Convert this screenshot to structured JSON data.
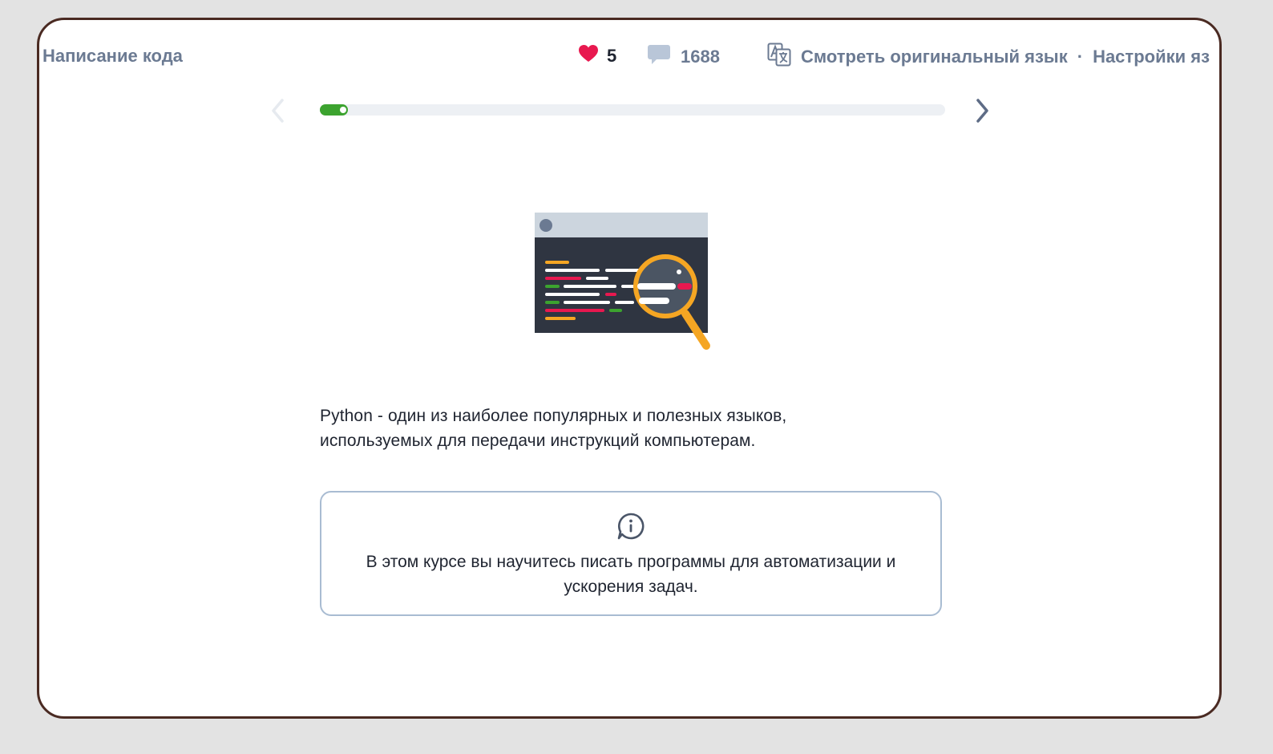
{
  "header": {
    "lesson_title": "Написание кода",
    "likes_count": "5",
    "comments_count": "1688",
    "view_original_label": "Смотреть оригинальный язык",
    "separator": "·",
    "language_settings_label": "Настройки яз"
  },
  "progress": {
    "fraction": 0.045
  },
  "content": {
    "intro_line1": "Python - один из наиболее популярных и полезных языков,",
    "intro_line2": "используемых для передачи инструкций компьютерам.",
    "info_text": "В этом курсе вы научитесь писать программы для автоматизации и ускорения задач."
  },
  "icons": {
    "like": "heart-icon",
    "comments": "comment-bubble-icon",
    "translate": "translate-icon",
    "prev": "chevron-left-icon",
    "next": "chevron-right-icon",
    "info": "info-bubble-icon",
    "illustration": "code-magnifier-illustration"
  },
  "colors": {
    "heart": "#e8184f",
    "progress_fill": "#3ca32f",
    "progress_track": "#edf0f4",
    "muted_text": "#6b7a92",
    "frame_border": "#4a2a22",
    "card_border": "#a9bcd2"
  }
}
